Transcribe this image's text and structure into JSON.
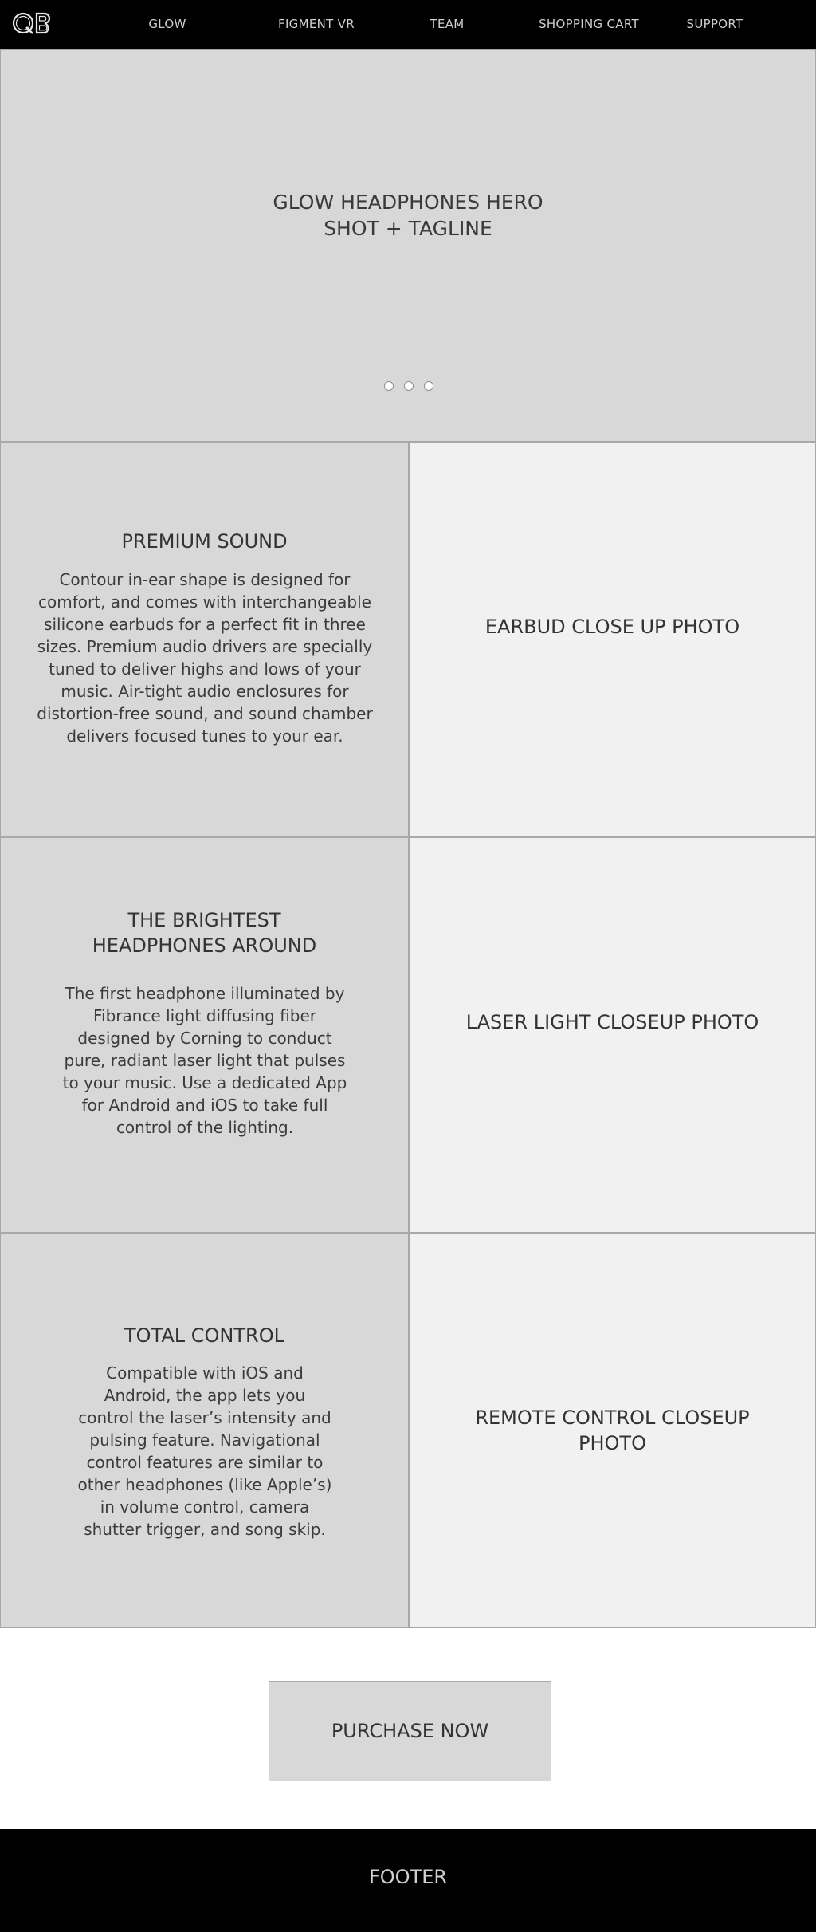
{
  "nav": {
    "logo_text": "QB",
    "items": [
      {
        "label": "GLOW"
      },
      {
        "label": "FIGMENT VR"
      },
      {
        "label": "TEAM"
      },
      {
        "label": "SHOPPING CART"
      },
      {
        "label": "SUPPORT"
      }
    ]
  },
  "hero": {
    "line1": "GLOW HEADPHONES HERO",
    "line2": "SHOT + TAGLINE",
    "carousel_dots": 3
  },
  "features": [
    {
      "title_lines": [
        "PREMIUM SOUND"
      ],
      "body": "Contour in-ear shape is designed for comfort, and comes with interchangeable silicone earbuds for a perfect fit in three sizes. Premium audio drivers are specially tuned to deliver highs and lows of your music. Air-tight audio enclosures for distortion-free sound, and sound chamber delivers focused tunes to your ear.",
      "photo_lines": [
        "EARBUD CLOSE UP PHOTO"
      ]
    },
    {
      "title_lines": [
        "THE BRIGHTEST",
        "HEADPHONES AROUND"
      ],
      "body": "The first headphone illuminated by Fibrance light diffusing fiber designed by Corning to conduct pure, radiant laser light that pulses to your music. Use a dedicated App for Android and iOS to take full control of the lighting.",
      "photo_lines": [
        "LASER LIGHT CLOSEUP PHOTO"
      ]
    },
    {
      "title_lines": [
        "TOTAL CONTROL"
      ],
      "body": "Compatible with iOS and Android, the app lets you control the laser’s intensity and pulsing feature. Navigational control features are similar to other headphones (like Apple’s) in volume control, camera shutter trigger, and song skip.",
      "photo_lines": [
        "REMOTE CONTROL CLOSEUP",
        "PHOTO"
      ]
    }
  ],
  "purchase": {
    "label": "PURCHASE NOW"
  },
  "footer": {
    "label": "FOOTER"
  }
}
